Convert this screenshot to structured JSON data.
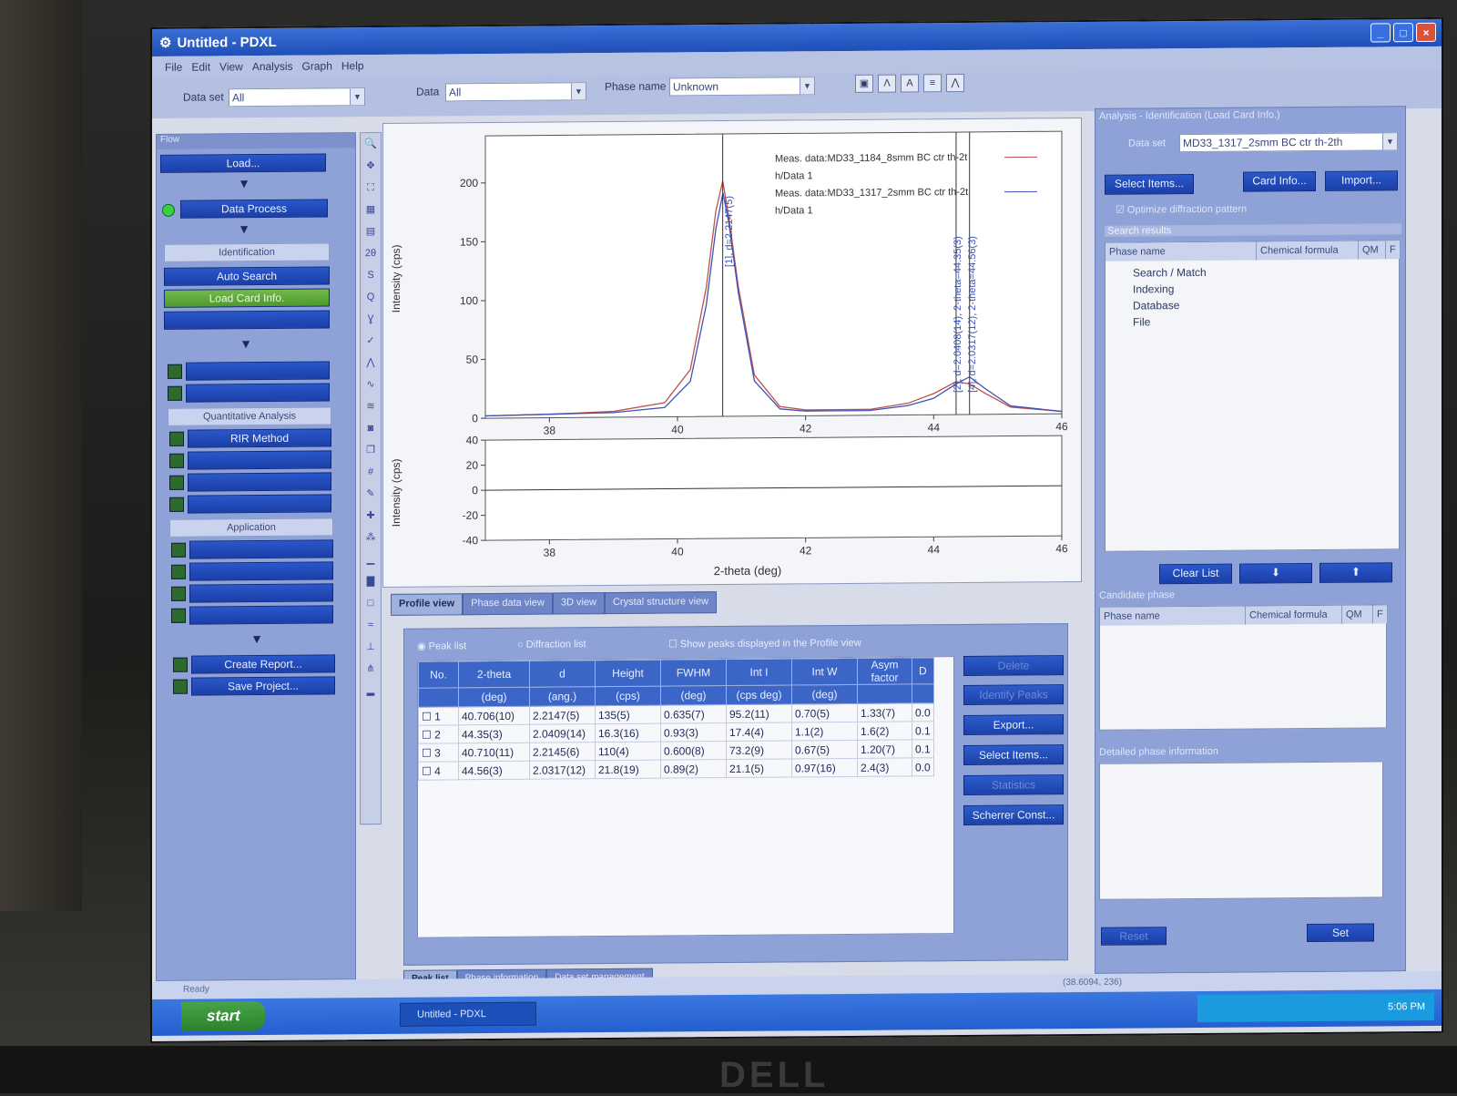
{
  "window": {
    "title": "Untitled - PDXL",
    "controls": [
      "_",
      "□",
      "×"
    ]
  },
  "menu": [
    "File",
    "Edit",
    "View",
    "Analysis",
    "Graph",
    "Help"
  ],
  "toolbar": {
    "dataset_label": "Data set",
    "dataset_value": "All",
    "data_label": "Data",
    "data_value": "All",
    "phase_label": "Phase name",
    "phase_value": "Unknown",
    "icons": [
      "zoom-fit-icon",
      "peak-icon",
      "label-icon",
      "overlay-icon",
      "lattice-icon"
    ]
  },
  "flow": {
    "header": "Flow",
    "load": "Load...",
    "data_process": "Data Process",
    "identification": "Identification",
    "auto_search": "Auto Search",
    "load_card": "Load Card Info.",
    "quant": "Quantitative Analysis",
    "rir": "RIR Method",
    "application": "Application",
    "create_report": "Create Report...",
    "save_project": "Save Project..."
  },
  "view_tabs": [
    "Profile view",
    "Phase data view",
    "3D view",
    "Crystal structure view"
  ],
  "chart_data": {
    "type": "line",
    "xlabel": "2-theta (deg)",
    "ylabel": "Intensity (cps)",
    "xlim": [
      37,
      46
    ],
    "ylim": [
      0,
      240
    ],
    "xticks": [
      "38",
      "40",
      "42",
      "44",
      "46"
    ],
    "yticks": [
      "0",
      "50",
      "100",
      "150",
      "200"
    ],
    "legend": [
      "Meas. data:MD33_1184_8smm BC ctr th-2t",
      "h/Data 1",
      "Meas. data:MD33_1317_2smm BC ctr th-2t",
      "h/Data 1"
    ],
    "series": [
      {
        "name": "Meas. data:MD33_1184_8smm BC ctr th-2t",
        "color": "#c0504d",
        "x": [
          37,
          38,
          39,
          39.8,
          40.2,
          40.45,
          40.6,
          40.706,
          40.8,
          40.95,
          41.2,
          41.6,
          42,
          43,
          43.6,
          44,
          44.35,
          44.56,
          44.8,
          45.2,
          46
        ],
        "y": [
          2,
          3,
          5,
          12,
          40,
          110,
          175,
          200,
          170,
          110,
          35,
          8,
          5,
          5,
          10,
          18,
          28,
          26,
          18,
          6,
          2
        ]
      },
      {
        "name": "Meas. data:MD33_1317_2smm BC ctr th-2t",
        "color": "#3a53b8",
        "x": [
          37,
          38,
          39,
          39.8,
          40.2,
          40.45,
          40.6,
          40.71,
          40.8,
          40.95,
          41.2,
          41.6,
          42,
          43,
          43.6,
          44,
          44.35,
          44.56,
          44.8,
          45.2,
          46
        ],
        "y": [
          2,
          3,
          4,
          8,
          30,
          95,
          160,
          190,
          165,
          105,
          30,
          6,
          4,
          4,
          8,
          14,
          26,
          32,
          22,
          7,
          2
        ]
      }
    ],
    "peak_labels": [
      "[2], d=2.0408(14), 2-theta=44.35(3)",
      "[4], d=2.0317(12), 2-theta=44.56(3)",
      "[1], d=2.2147(5)"
    ],
    "residual": {
      "ylim": [
        -40,
        40
      ],
      "yticks": [
        "40",
        "20",
        "0",
        "-20",
        "-40"
      ],
      "xticks": [
        "38",
        "40",
        "42",
        "44",
        "46"
      ]
    }
  },
  "lower": {
    "radio_peak": "Peak list",
    "radio_diff": "Diffraction list",
    "show_peaks": "Show peaks displayed in the Profile view",
    "columns": [
      "No.",
      "2-theta",
      "d",
      "Height",
      "FWHM",
      "Int I",
      "Int W",
      "Asym factor",
      "D"
    ],
    "units": [
      "",
      "(deg)",
      "(ang.)",
      "(cps)",
      "(deg)",
      "(cps deg)",
      "(deg)",
      "",
      ""
    ],
    "rows": [
      [
        "1",
        "40.706(10)",
        "2.2147(5)",
        "135(5)",
        "0.635(7)",
        "95.2(11)",
        "0.70(5)",
        "1.33(7)",
        "0.0"
      ],
      [
        "2",
        "44.35(3)",
        "2.0409(14)",
        "16.3(16)",
        "0.93(3)",
        "17.4(4)",
        "1.1(2)",
        "1.6(2)",
        "0.1"
      ],
      [
        "3",
        "40.710(11)",
        "2.2145(6)",
        "110(4)",
        "0.600(8)",
        "73.2(9)",
        "0.67(5)",
        "1.20(7)",
        "0.1"
      ],
      [
        "4",
        "44.56(3)",
        "2.0317(12)",
        "21.8(19)",
        "0.89(2)",
        "21.1(5)",
        "0.97(16)",
        "2.4(3)",
        "0.0"
      ]
    ],
    "buttons": [
      "Delete",
      "Identify Peaks",
      "Export...",
      "Select Items...",
      "Statistics",
      "Scherrer Const..."
    ],
    "tabs": [
      "Peak list",
      "Phase information",
      "Data set management"
    ]
  },
  "right": {
    "header": "Analysis - Identification (Load Card Info.)",
    "dataset_label": "Data set",
    "dataset_value": "MD33_1317_2smm BC ctr th-2th",
    "select_items": "Select Items...",
    "card_info": "Card Info...",
    "import": "Import...",
    "optimize": "Optimize diffraction pattern",
    "search_results": "Search results",
    "cols": [
      "Phase name",
      "Chemical formula",
      "QM",
      "F"
    ],
    "tree": [
      "Search / Match",
      "Indexing",
      "Database",
      "File"
    ],
    "clear_list": "Clear List",
    "candidate": "Candidate phase",
    "detailed": "Detailed phase information",
    "set": "Set",
    "reset": "Reset"
  },
  "status": {
    "ready": "Ready",
    "coords": "(38.6094, 236)"
  },
  "taskbar": {
    "start": "start",
    "task": "Untitled - PDXL",
    "clock": "5:06 PM"
  }
}
